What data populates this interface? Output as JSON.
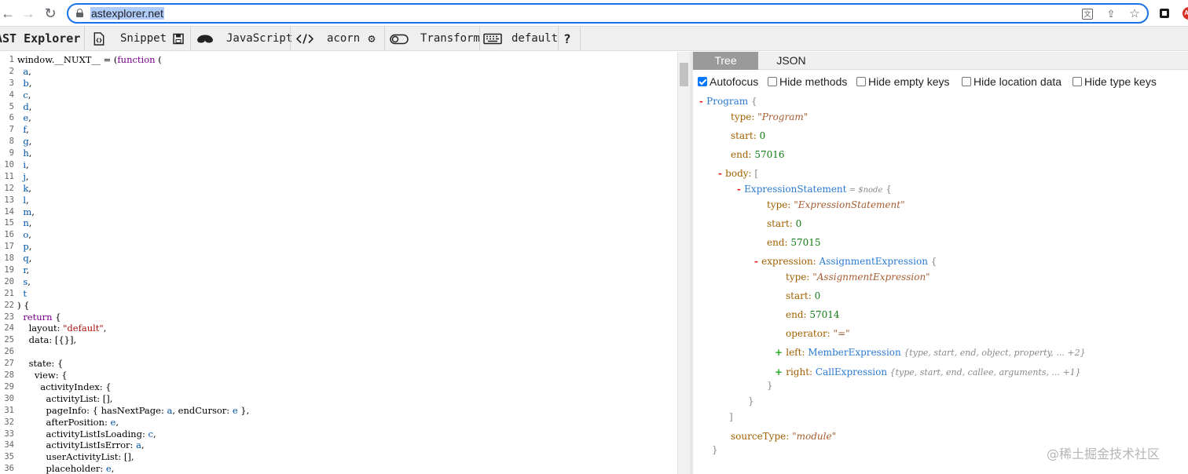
{
  "browser": {
    "url": "astexplorer.net",
    "back_glyph": "←",
    "forward_glyph": "→",
    "reload_glyph": "↻",
    "translate_glyph": "文",
    "share_glyph": "⇪",
    "star_glyph": "☆"
  },
  "toolbar": {
    "brand": "AST Explorer",
    "snippet": "Snippet",
    "language": "JavaScript",
    "parser": "acorn",
    "transform": "Transform",
    "keymap": "default",
    "help": "?"
  },
  "editor": {
    "lines": [
      [
        {
          "t": "window.__NUXT__ = ("
        },
        {
          "t": "function",
          "c": "kw"
        },
        {
          "t": " ("
        }
      ],
      [
        {
          "t": "  "
        },
        {
          "t": "a",
          "c": "var"
        },
        {
          "t": ","
        }
      ],
      [
        {
          "t": "  "
        },
        {
          "t": "b",
          "c": "var"
        },
        {
          "t": ","
        }
      ],
      [
        {
          "t": "  "
        },
        {
          "t": "c",
          "c": "var"
        },
        {
          "t": ","
        }
      ],
      [
        {
          "t": "  "
        },
        {
          "t": "d",
          "c": "var"
        },
        {
          "t": ","
        }
      ],
      [
        {
          "t": "  "
        },
        {
          "t": "e",
          "c": "var"
        },
        {
          "t": ","
        }
      ],
      [
        {
          "t": "  "
        },
        {
          "t": "f",
          "c": "var"
        },
        {
          "t": ","
        }
      ],
      [
        {
          "t": "  "
        },
        {
          "t": "g",
          "c": "var"
        },
        {
          "t": ","
        }
      ],
      [
        {
          "t": "  "
        },
        {
          "t": "h",
          "c": "var"
        },
        {
          "t": ","
        }
      ],
      [
        {
          "t": "  "
        },
        {
          "t": "i",
          "c": "var"
        },
        {
          "t": ","
        }
      ],
      [
        {
          "t": "  "
        },
        {
          "t": "j",
          "c": "var"
        },
        {
          "t": ","
        }
      ],
      [
        {
          "t": "  "
        },
        {
          "t": "k",
          "c": "var"
        },
        {
          "t": ","
        }
      ],
      [
        {
          "t": "  "
        },
        {
          "t": "l",
          "c": "var"
        },
        {
          "t": ","
        }
      ],
      [
        {
          "t": "  "
        },
        {
          "t": "m",
          "c": "var"
        },
        {
          "t": ","
        }
      ],
      [
        {
          "t": "  "
        },
        {
          "t": "n",
          "c": "var"
        },
        {
          "t": ","
        }
      ],
      [
        {
          "t": "  "
        },
        {
          "t": "o",
          "c": "var"
        },
        {
          "t": ","
        }
      ],
      [
        {
          "t": "  "
        },
        {
          "t": "p",
          "c": "var"
        },
        {
          "t": ","
        }
      ],
      [
        {
          "t": "  "
        },
        {
          "t": "q",
          "c": "var"
        },
        {
          "t": ","
        }
      ],
      [
        {
          "t": "  "
        },
        {
          "t": "r",
          "c": "var"
        },
        {
          "t": ","
        }
      ],
      [
        {
          "t": "  "
        },
        {
          "t": "s",
          "c": "var"
        },
        {
          "t": ","
        }
      ],
      [
        {
          "t": "  "
        },
        {
          "t": "t",
          "c": "var"
        }
      ],
      [
        {
          "t": ") {"
        }
      ],
      [
        {
          "t": "  "
        },
        {
          "t": "return",
          "c": "kw"
        },
        {
          "t": " {"
        }
      ],
      [
        {
          "t": "    layout: "
        },
        {
          "t": "\"default\"",
          "c": "str"
        },
        {
          "t": ","
        }
      ],
      [
        {
          "t": "    data: [{}],"
        }
      ],
      [
        {
          "t": ""
        }
      ],
      [
        {
          "t": "    state: {"
        }
      ],
      [
        {
          "t": "      view: {"
        }
      ],
      [
        {
          "t": "        activityIndex: {"
        }
      ],
      [
        {
          "t": "          activityList: [],"
        }
      ],
      [
        {
          "t": "          pageInfo: { hasNextPage: "
        },
        {
          "t": "a",
          "c": "var"
        },
        {
          "t": ", endCursor: "
        },
        {
          "t": "e",
          "c": "var"
        },
        {
          "t": " },"
        }
      ],
      [
        {
          "t": "          afterPosition: "
        },
        {
          "t": "e",
          "c": "var"
        },
        {
          "t": ","
        }
      ],
      [
        {
          "t": "          activityListIsLoading: "
        },
        {
          "t": "c",
          "c": "var"
        },
        {
          "t": ","
        }
      ],
      [
        {
          "t": "          activityListIsError: "
        },
        {
          "t": "a",
          "c": "var"
        },
        {
          "t": ","
        }
      ],
      [
        {
          "t": "          userActivityList: [],"
        }
      ],
      [
        {
          "t": "          placeholder: "
        },
        {
          "t": "e",
          "c": "var"
        },
        {
          "t": ","
        }
      ]
    ]
  },
  "output": {
    "tabs": [
      "Tree",
      "JSON"
    ],
    "options": [
      {
        "label": "Autofocus",
        "checked": true
      },
      {
        "label": "Hide methods",
        "checked": false
      },
      {
        "label": "Hide empty keys",
        "checked": false
      },
      {
        "label": "Hide location data",
        "checked": false
      },
      {
        "label": "Hide type keys",
        "checked": false
      }
    ],
    "tree": [
      [
        {
          "t": "- ",
          "c": "toggle"
        },
        {
          "t": "Program",
          "c": "node"
        },
        {
          "t": "   {",
          "c": "brk"
        }
      ],
      [
        {
          "t": "type:  ",
          "c": "key"
        },
        {
          "t": "\"Program\"",
          "c": "tstr"
        }
      ],
      [
        {
          "t": "start:  ",
          "c": "key"
        },
        {
          "t": "0",
          "c": "num"
        }
      ],
      [
        {
          "t": "end:  ",
          "c": "key"
        },
        {
          "t": "57016",
          "c": "num"
        }
      ],
      [
        {
          "t": "- ",
          "c": "toggle"
        },
        {
          "t": "body:  ",
          "c": "key"
        },
        {
          "t": "  [",
          "c": "brk"
        }
      ],
      [
        {
          "t": "- ",
          "c": "toggle"
        },
        {
          "t": "ExpressionStatement",
          "c": "node"
        },
        {
          "t": "  = $node",
          "c": "sn"
        },
        {
          "t": "  {",
          "c": "brk"
        }
      ],
      [
        {
          "t": "type:  ",
          "c": "key"
        },
        {
          "t": "\"ExpressionStatement\"",
          "c": "tstr"
        }
      ],
      [
        {
          "t": "start:  ",
          "c": "key"
        },
        {
          "t": "0",
          "c": "num"
        }
      ],
      [
        {
          "t": "end:  ",
          "c": "key"
        },
        {
          "t": "57015",
          "c": "num"
        }
      ],
      [
        {
          "t": "- ",
          "c": "toggle"
        },
        {
          "t": "expression:  ",
          "c": "key"
        },
        {
          "t": "AssignmentExpression",
          "c": "node"
        },
        {
          "t": "    {",
          "c": "brk"
        }
      ],
      [
        {
          "t": "type:  ",
          "c": "key"
        },
        {
          "t": "\"AssignmentExpression\"",
          "c": "tstr"
        }
      ],
      [
        {
          "t": "start:  ",
          "c": "key"
        },
        {
          "t": "0",
          "c": "num"
        }
      ],
      [
        {
          "t": "end:  ",
          "c": "key"
        },
        {
          "t": "57014",
          "c": "num"
        }
      ],
      [
        {
          "t": "operator:  ",
          "c": "key"
        },
        {
          "t": "\"=\"",
          "c": "tstr"
        }
      ],
      [
        {
          "t": "+ ",
          "c": "toggle-plus"
        },
        {
          "t": "left:  ",
          "c": "key"
        },
        {
          "t": "MemberExpression",
          "c": "node"
        },
        {
          "t": " {type, start, end, object, property, ... +2}",
          "c": "summary"
        }
      ],
      [
        {
          "t": "+ ",
          "c": "toggle-plus"
        },
        {
          "t": "right:  ",
          "c": "key"
        },
        {
          "t": "CallExpression",
          "c": "node"
        },
        {
          "t": " {type, start, end, callee, arguments, ... +1}",
          "c": "summary"
        }
      ],
      [
        {
          "t": "}",
          "c": "brk"
        }
      ],
      [
        {
          "t": "}",
          "c": "brk"
        }
      ],
      [
        {
          "t": "]",
          "c": "brk"
        }
      ],
      [
        {
          "t": "sourceType:  ",
          "c": "key"
        },
        {
          "t": "\"module\"",
          "c": "tstr"
        }
      ],
      [
        {
          "t": "}",
          "c": "brk"
        }
      ]
    ]
  },
  "watermark": "@稀土掘金技术社区"
}
